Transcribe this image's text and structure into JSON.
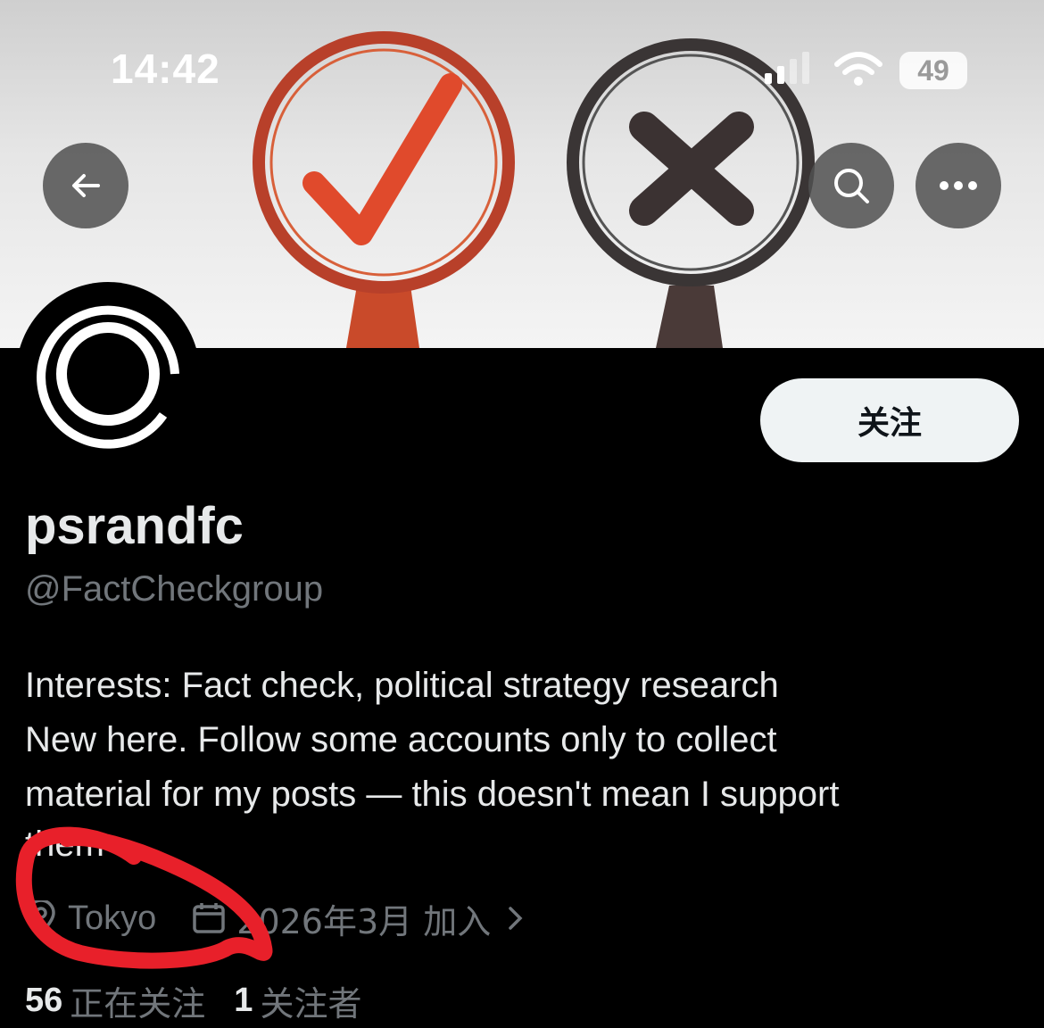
{
  "status_bar": {
    "time": "14:42",
    "battery": "49",
    "signal_icon": "cellular-signal-icon",
    "wifi_icon": "wifi-icon"
  },
  "header": {
    "back_icon": "back-arrow-icon",
    "search_icon": "search-icon",
    "more_icon": "more-icon"
  },
  "profile": {
    "display_name": "psrandfc",
    "handle": "@FactCheckgroup",
    "follow_label": "关注",
    "bio": "Interests: Fact check, political strategy research\nNew here. Follow some accounts only to collect\nmaterial for my posts — this doesn't mean I support",
    "bio_tail": "them",
    "location": "Tokyo",
    "joined": "2026年3月 加入",
    "following_count": "56",
    "following_label": "正在关注",
    "followers_count": "1",
    "followers_label": "关注者"
  },
  "colors": {
    "background": "#000000",
    "primary_text": "#e7e9ea",
    "secondary_text": "#71767b",
    "follow_button_bg": "#eff3f4",
    "annotation_red": "#e8202a",
    "check_red": "#d8452a"
  }
}
